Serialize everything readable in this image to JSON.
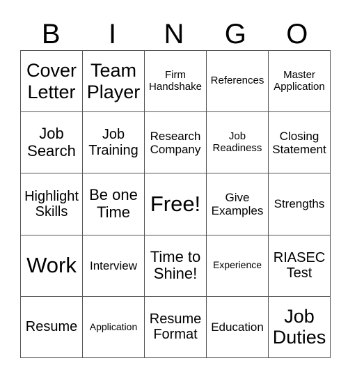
{
  "card": {
    "header_letters": [
      "B",
      "I",
      "N",
      "G",
      "O"
    ],
    "rows": [
      [
        "Cover Letter",
        "Team Player",
        "Firm Handshake",
        "References",
        "Master Application"
      ],
      [
        "Job Search",
        "Job Training",
        "Research Company",
        "Job Readiness",
        "Closing Statement"
      ],
      [
        "Highlight Skills",
        "Be one Time",
        "Free!",
        "Give Examples",
        "Strengths"
      ],
      [
        "Work",
        "Interview",
        "Time to Shine!",
        "Experience",
        "RIASEC Test"
      ],
      [
        "Resume",
        "Application",
        "Resume Format",
        "Education",
        "Job Duties"
      ]
    ]
  }
}
